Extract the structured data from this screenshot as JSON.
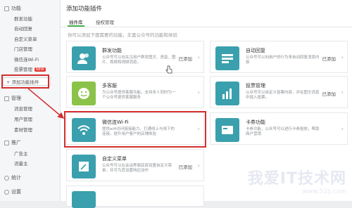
{
  "sidebar": {
    "sections": [
      {
        "label": "功能",
        "items": [
          "群发功能",
          "自动回复",
          "自定义菜单",
          "门店管理",
          "微信连Wi-Fi",
          "投票管理"
        ]
      },
      {
        "label": "管理",
        "items": [
          "消息管理",
          "用户管理",
          "素材管理"
        ]
      },
      {
        "label": "推广",
        "items": [
          "广告主",
          "流量主"
        ]
      },
      {
        "label": "统计",
        "items": []
      },
      {
        "label": "设置",
        "items": []
      }
    ],
    "new_badge": "NEW",
    "add_plugin_label": "+ 添加功能插件"
  },
  "main": {
    "title": "添加功能插件",
    "tabs": [
      "插件库",
      "授权管理"
    ],
    "hint": "你可以添加下面需要的功能，丰富公众号的功能和体验",
    "cards": [
      {
        "name": "群发功能",
        "desc": "公众号可以向关注用户群发图文、语音、图片、视频和视频消息。",
        "status": "已添加"
      },
      {
        "name": "自动回复",
        "desc": "公众号可以向用户的行为来自动回复消息内容",
        "status": "已添加"
      },
      {
        "name": "多客服",
        "desc": "为公众号提供客服功能，支持多人同时为一个公众号提供客服服务",
        "status": ""
      },
      {
        "name": "投票管理",
        "desc": "公众号可以自定义投票内容，并在图文消息中插入投票。",
        "status": "已添加"
      },
      {
        "name": "微信连Wi-Fi",
        "desc": "提供wifi访问链接能力，打通线上与线下的连接，提升用户客户的店铺体验",
        "status": ""
      },
      {
        "name": "卡券功能",
        "desc": "卡券功能，公众号可以进行卡券投放，帮助商户营销",
        "status": ""
      },
      {
        "name": "自定义菜单",
        "desc": "公众号可以在会话界面底部设置自定义菜单，并可为其设置响应动作",
        "status": "已添加"
      }
    ]
  },
  "watermark": {
    "line1": "我爱IT技术网",
    "line2": "www.52ij.com"
  },
  "colors": {
    "accent": "#44b549",
    "teal": "#3aa0ad",
    "highlight": "#d32f2f"
  }
}
